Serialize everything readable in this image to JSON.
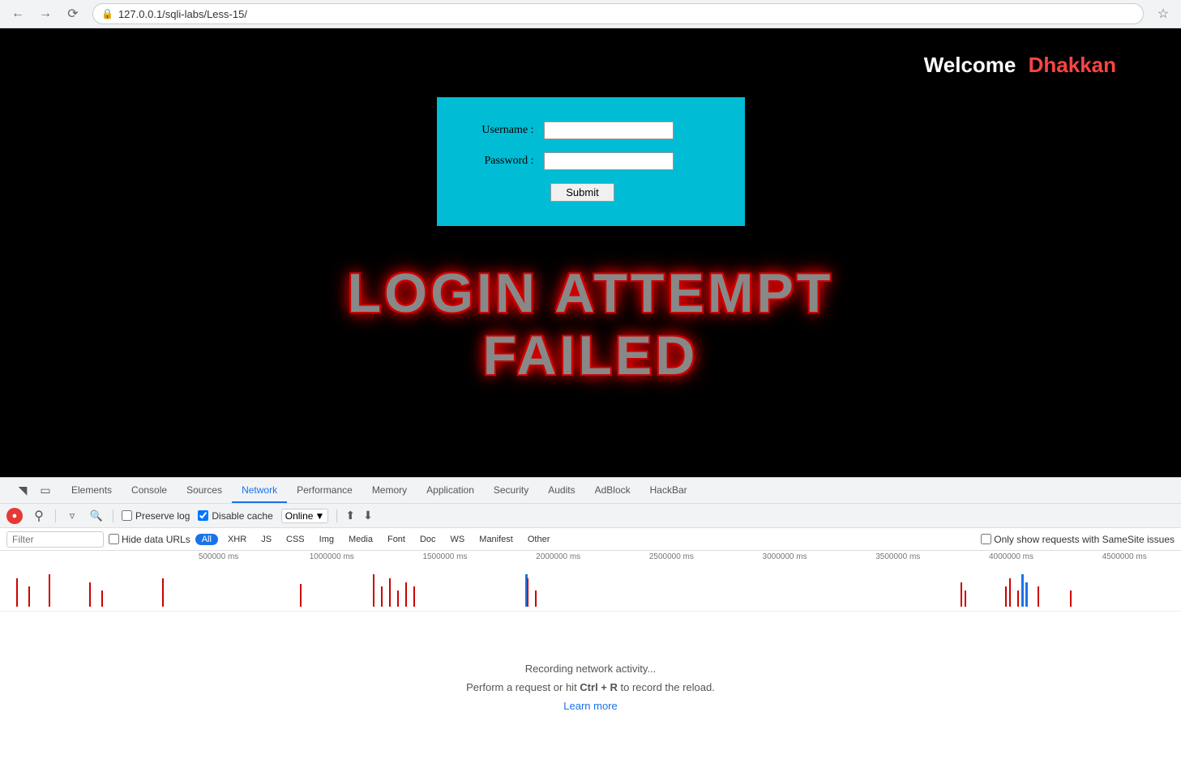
{
  "browser": {
    "url": "127.0.0.1/sqli-labs/Less-15/",
    "back_disabled": false,
    "forward_disabled": true
  },
  "webpage": {
    "welcome_label": "Welcome",
    "welcome_name": "Dhakkan",
    "form": {
      "username_label": "Username :",
      "password_label": "Password :",
      "submit_label": "Submit"
    },
    "login_failed_line1": "LOGIN ATTEMPT",
    "login_failed_line2": "FAILED"
  },
  "devtools": {
    "tabs": [
      {
        "label": "Elements",
        "active": false
      },
      {
        "label": "Console",
        "active": false
      },
      {
        "label": "Sources",
        "active": false
      },
      {
        "label": "Network",
        "active": true
      },
      {
        "label": "Performance",
        "active": false
      },
      {
        "label": "Memory",
        "active": false
      },
      {
        "label": "Application",
        "active": false
      },
      {
        "label": "Security",
        "active": false
      },
      {
        "label": "Audits",
        "active": false
      },
      {
        "label": "AdBlock",
        "active": false
      },
      {
        "label": "HackBar",
        "active": false
      }
    ],
    "toolbar": {
      "preserve_log_label": "Preserve log",
      "disable_cache_label": "Disable cache",
      "online_label": "Online",
      "preserve_log_checked": false,
      "disable_cache_checked": true
    },
    "filter": {
      "placeholder": "Filter",
      "hide_data_urls_label": "Hide data URLs",
      "types": [
        "All",
        "XHR",
        "JS",
        "CSS",
        "Img",
        "Media",
        "Font",
        "Doc",
        "WS",
        "Manifest",
        "Other"
      ],
      "active_type": "All",
      "samesite_label": "Only show requests with SameSite issues"
    },
    "timeline": {
      "labels": [
        "500000 ms",
        "1000000 ms",
        "1500000 ms",
        "2000000 ms",
        "2500000 ms",
        "3000000 ms",
        "3500000 ms",
        "4000000 ms",
        "4500000 ms"
      ]
    },
    "network_activity": {
      "line1": "Recording network activity...",
      "line2_before": "Perform a request or hit ",
      "line2_shortcut": "Ctrl + R",
      "line2_after": " to record the reload.",
      "learn_more": "Learn more"
    }
  }
}
